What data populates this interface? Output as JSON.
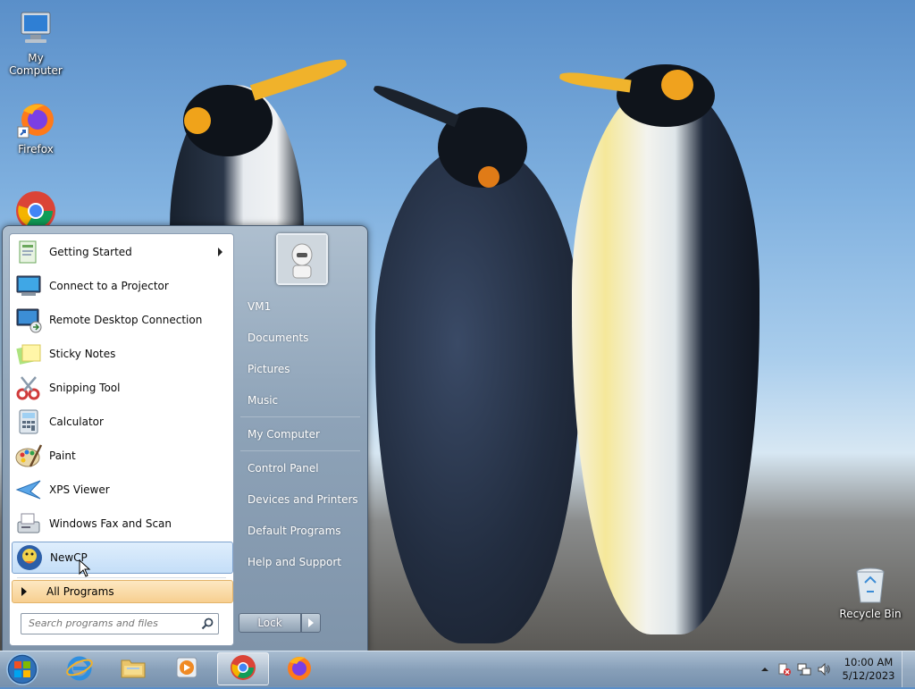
{
  "desktop": {
    "icons": [
      {
        "label": "My Computer",
        "icon": "computer-icon"
      },
      {
        "label": "Firefox",
        "icon": "firefox-icon"
      },
      {
        "label": "",
        "icon": "chrome-icon"
      },
      {
        "label": "Recycle Bin",
        "icon": "recycle-bin-icon"
      }
    ]
  },
  "start_menu": {
    "programs": [
      {
        "label": "Getting Started",
        "icon": "getting-started-icon",
        "has_submenu": true
      },
      {
        "label": "Connect to a Projector",
        "icon": "projector-icon"
      },
      {
        "label": "Remote Desktop Connection",
        "icon": "remote-desktop-icon"
      },
      {
        "label": "Sticky Notes",
        "icon": "sticky-notes-icon"
      },
      {
        "label": "Snipping Tool",
        "icon": "snipping-tool-icon"
      },
      {
        "label": "Calculator",
        "icon": "calculator-icon"
      },
      {
        "label": "Paint",
        "icon": "paint-icon"
      },
      {
        "label": "XPS Viewer",
        "icon": "xps-viewer-icon"
      },
      {
        "label": "Windows Fax and Scan",
        "icon": "fax-scan-icon"
      },
      {
        "label": "NewCP",
        "icon": "newcp-icon",
        "selected": true
      }
    ],
    "all_programs_label": "All Programs",
    "search_placeholder": "Search programs and files",
    "right_links": [
      {
        "label": "VM1"
      },
      {
        "label": "Documents"
      },
      {
        "label": "Pictures"
      },
      {
        "label": "Music"
      },
      {
        "label": "My Computer"
      },
      {
        "label": "Control Panel"
      },
      {
        "label": "Devices and Printers"
      },
      {
        "label": "Default Programs"
      },
      {
        "label": "Help and Support"
      }
    ],
    "lock_label": "Lock"
  },
  "taskbar": {
    "pinned": [
      {
        "name": "internet-explorer-icon"
      },
      {
        "name": "file-explorer-icon"
      },
      {
        "name": "media-player-icon"
      },
      {
        "name": "chrome-icon",
        "active": true
      },
      {
        "name": "firefox-icon"
      }
    ],
    "clock_time": "10:00 AM",
    "clock_date": "5/12/2023"
  },
  "colors": {
    "selected_item": "#c4def8",
    "all_programs": "#f7cf90",
    "menu_frame": "#8ea3b8"
  }
}
